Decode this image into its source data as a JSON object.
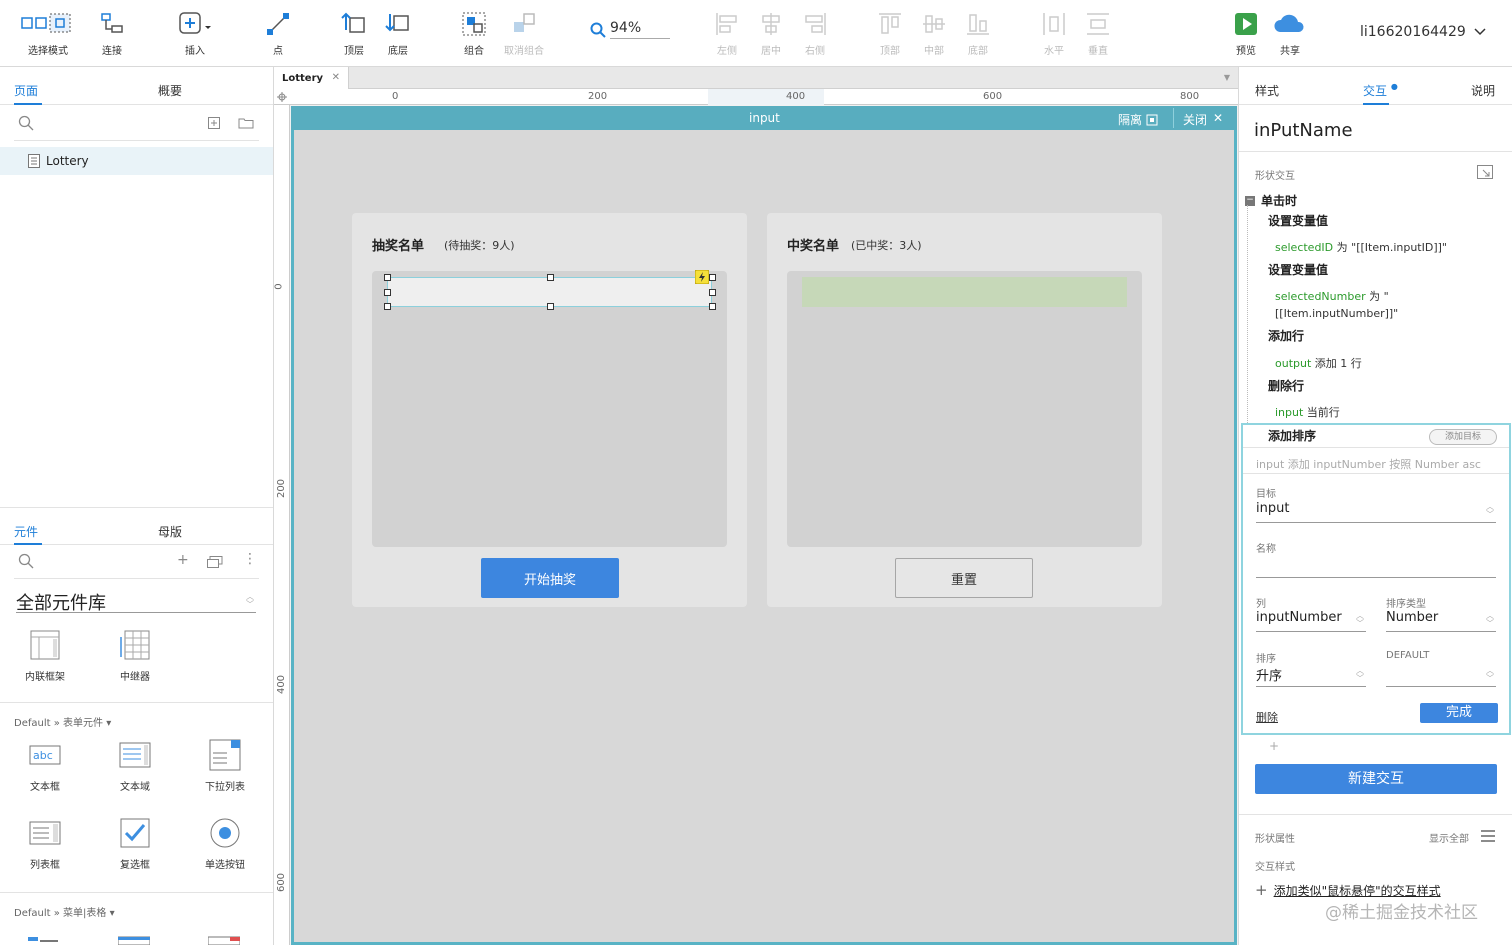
{
  "toolbar": {
    "items": [
      {
        "label": "选择模式",
        "icon": "select-mode-icon"
      },
      {
        "label": "连接",
        "icon": "connect-icon"
      },
      {
        "label": "插入",
        "icon": "insert-icon"
      },
      {
        "label": "点",
        "icon": "point-icon"
      },
      {
        "label": "顶层",
        "icon": "bring-to-front-icon"
      },
      {
        "label": "底层",
        "icon": "send-to-back-icon"
      },
      {
        "label": "组合",
        "icon": "group-icon"
      },
      {
        "label": "取消组合",
        "icon": "ungroup-icon"
      },
      {
        "label": "左侧",
        "icon": "align-left-icon"
      },
      {
        "label": "居中",
        "icon": "align-center-icon"
      },
      {
        "label": "右侧",
        "icon": "align-right-icon"
      },
      {
        "label": "顶部",
        "icon": "align-top-icon"
      },
      {
        "label": "中部",
        "icon": "align-middle-icon"
      },
      {
        "label": "底部",
        "icon": "align-bottom-icon"
      },
      {
        "label": "水平",
        "icon": "distribute-horizontal-icon"
      },
      {
        "label": "垂直",
        "icon": "distribute-vertical-icon"
      },
      {
        "label": "预览",
        "icon": "preview-icon"
      },
      {
        "label": "共享",
        "icon": "share-cloud-icon"
      }
    ],
    "zoom": "94%",
    "username": "li16620164429"
  },
  "left": {
    "tab_pages": "页面",
    "tab_outline": "概要",
    "page_item": "Lottery",
    "tab_widgets": "元件",
    "tab_masters": "母版",
    "library": "全部元件库",
    "lib_items_1": [
      "内联框架",
      "中继器"
    ],
    "section_forms": "Default » 表单元件",
    "form_items": [
      "文本框",
      "文本域",
      "下拉列表",
      "列表框",
      "复选框",
      "单选按钮"
    ],
    "section_menus": "Default » 菜单|表格"
  },
  "canvas": {
    "doc_tab": "Lottery",
    "ruler_h": [
      "0",
      "200",
      "400",
      "600",
      "800"
    ],
    "ruler_v": [
      "0",
      "200",
      "400",
      "600"
    ],
    "frame_title": "input",
    "isolate": "隔离",
    "close": "关闭",
    "left_panel_title": "抽奖名单",
    "left_panel_sub": "(待抽奖：9人)",
    "right_panel_title": "中奖名单",
    "right_panel_sub": "(已中奖：3人)",
    "start_button": "开始抽奖",
    "reset_button": "重置"
  },
  "right": {
    "tab_style": "样式",
    "tab_interact": "交互",
    "tab_notes": "说明",
    "widget_name": "inPutName",
    "shape_interactions": "形状交互",
    "event": "单击时",
    "actions": [
      {
        "title": "设置变量值",
        "detail_green": "selectedID",
        "detail": " 为 \"[[Item.inputID]]\""
      },
      {
        "title": "设置变量值",
        "detail_green": "selectedNumber",
        "detail": " 为 \"[[Item.inputNumber]]\""
      },
      {
        "title": "添加行",
        "detail_green": "output",
        "detail": " 添加 1 行"
      },
      {
        "title": "删除行",
        "detail_green": "input",
        "detail": " 当前行"
      }
    ],
    "sort_action": "添加排序",
    "add_target": "添加目标",
    "sort_summary": "input 添加 inputNumber 按照 Number asc",
    "target_label": "目标",
    "target_value": "input",
    "name_label": "名称",
    "name_value": "",
    "column_label": "列",
    "column_value": "inputNumber",
    "sort_type_label": "排序类型",
    "sort_type_value": "Number",
    "order_label": "排序",
    "order_value": "升序",
    "default_label": "DEFAULT",
    "default_value": "",
    "delete": "删除",
    "done": "完成",
    "new_interaction": "新建交互",
    "shape_props": "形状属性",
    "show_all": "显示全部",
    "interaction_styles": "交互样式",
    "add_style_link": "添加类似\"鼠标悬停\"的交互样式"
  },
  "watermark": "@稀土掘金技术社区",
  "colors": {
    "accent": "#1e7ed8",
    "frame": "#58adbf",
    "button_blue": "#3d86df",
    "green_text": "#2b9a2b"
  }
}
